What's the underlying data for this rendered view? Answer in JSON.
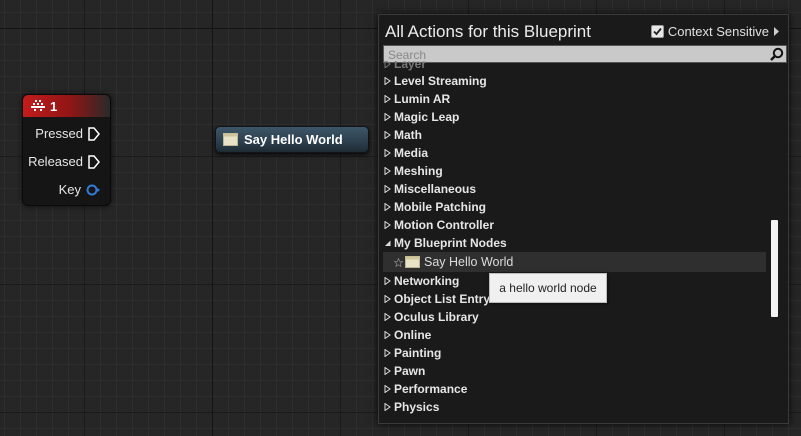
{
  "key_node": {
    "title": "1",
    "pins": [
      "Pressed",
      "Released",
      "Key"
    ]
  },
  "hello_node": {
    "title": "Say Hello World"
  },
  "action_menu": {
    "title": "All Actions for this Blueprint",
    "context_sensitive_label": "Context Sensitive",
    "context_sensitive_checked": true,
    "search_placeholder": "Search",
    "partial_item": "Layer",
    "categories": [
      "Level Streaming",
      "Lumin AR",
      "Magic Leap",
      "Math",
      "Media",
      "Meshing",
      "Miscellaneous",
      "Mobile Patching",
      "Motion Controller",
      "My Blueprint Nodes",
      "Networking",
      "Object List Entry",
      "Oculus Library",
      "Online",
      "Painting",
      "Pawn",
      "Performance",
      "Physics"
    ],
    "expanded_category": "My Blueprint Nodes",
    "selected_item": "Say Hello World",
    "tooltip": "a hello world node"
  },
  "colors": {
    "event_header": "#c41c1c",
    "function_header": "#3d5668",
    "key_pin": "#2f7bd6",
    "background": "#262626"
  },
  "icons": {
    "event": "keyboard-icon",
    "exec_pin": "exec-pin-icon",
    "key_pin": "struct-pin-icon",
    "function": "function-node-icon",
    "search": "search-icon",
    "expand": "triangle-right-icon",
    "collapse": "triangle-down-icon",
    "favorite": "star-icon"
  }
}
